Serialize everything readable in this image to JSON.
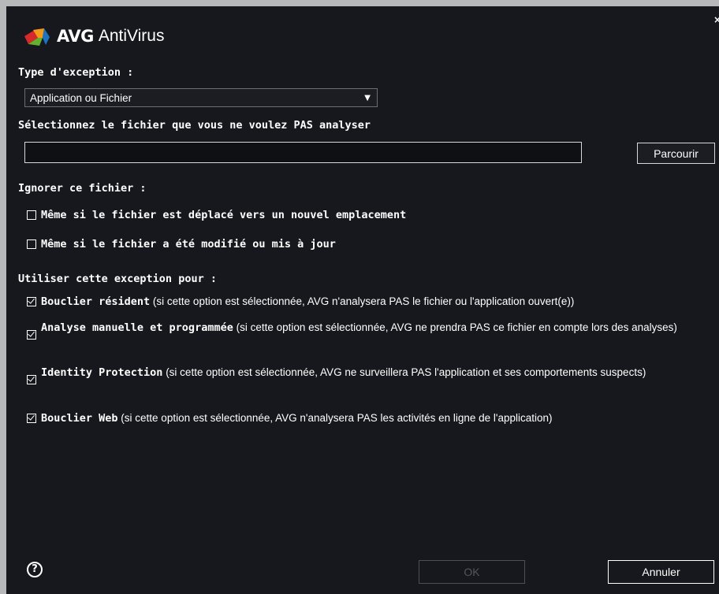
{
  "window": {
    "brand": "AVG",
    "product": "AntiVirus",
    "close_icon": "×"
  },
  "exception_type": {
    "label": "Type d'exception :",
    "selected": "Application ou Fichier",
    "arrow": "▼"
  },
  "file_select": {
    "label": "Sélectionnez le fichier que vous ne voulez PAS analyser",
    "value": "",
    "browse_label": "Parcourir"
  },
  "ignore": {
    "label": "Ignorer ce fichier :",
    "options": [
      {
        "text": "Même si le fichier est déplacé vers un nouvel emplacement",
        "checked": false
      },
      {
        "text": "Même si le fichier a été modifié ou mis à jour",
        "checked": false
      }
    ]
  },
  "use_for": {
    "label": "Utiliser cette exception pour :",
    "options": [
      {
        "title": "Bouclier résident",
        "desc": " (si cette option est sélectionnée, AVG n'analysera PAS le fichier ou l'application ouvert(e))",
        "checked": true
      },
      {
        "title": "Analyse manuelle et programmée",
        "desc": " (si cette option est sélectionnée, AVG ne prendra PAS ce fichier en compte lors des analyses)",
        "checked": true
      },
      {
        "title": "Identity Protection",
        "desc": " (si cette option est sélectionnée, AVG ne surveillera PAS l'application et ses comportements suspects)",
        "checked": true
      },
      {
        "title": "Bouclier Web",
        "desc": " (si cette option est sélectionnée, AVG n'analysera PAS les activités en ligne de l'application)",
        "checked": true
      }
    ]
  },
  "footer": {
    "help_icon": "?",
    "ok_label": "OK",
    "cancel_label": "Annuler"
  },
  "colors": {
    "background": "#17181d",
    "disabled": "#55565c",
    "logo_red": "#d5292a",
    "logo_orange": "#f39a1b",
    "logo_green": "#64b02e",
    "logo_blue": "#1e73be"
  }
}
